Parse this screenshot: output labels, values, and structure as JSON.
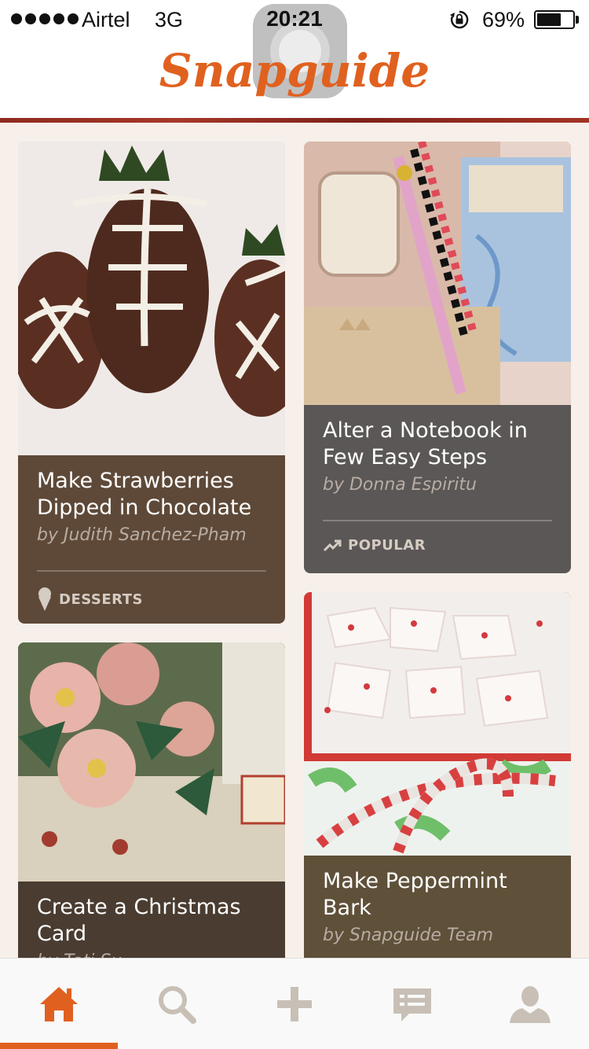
{
  "status_bar": {
    "carrier": "Airtel",
    "network": "3G",
    "time": "20:21",
    "battery_percent": "69%",
    "battery_level": 0.69
  },
  "header": {
    "logo_text": "Snapguide",
    "brand_color": "#e0611f"
  },
  "feed": {
    "cards": [
      {
        "title": "Make Strawberries Dipped in Chocolate",
        "author": "by Judith Sanchez-Pham",
        "tag": "DESSERTS",
        "tag_icon": "ice-cream-icon",
        "color": "#5e4938"
      },
      {
        "title": "Alter a Notebook in Few Easy Steps",
        "author": "by Donna Espiritu",
        "tag": "POPULAR",
        "tag_icon": "trending-icon",
        "color": "#5b5756"
      },
      {
        "title": "Create a Christmas Card",
        "author": "by Tati Su",
        "color": "#4a3c30"
      },
      {
        "title": "Make Peppermint Bark",
        "author": "by Snapguide Team",
        "color": "#5f5039"
      }
    ]
  },
  "tab_bar": {
    "tabs": [
      {
        "icon": "home-icon",
        "active": true
      },
      {
        "icon": "search-icon",
        "active": false
      },
      {
        "icon": "plus-icon",
        "active": false
      },
      {
        "icon": "messages-icon",
        "active": false
      },
      {
        "icon": "profile-icon",
        "active": false
      }
    ],
    "active_color": "#e0611f",
    "inactive_color": "#c8c0b6"
  }
}
